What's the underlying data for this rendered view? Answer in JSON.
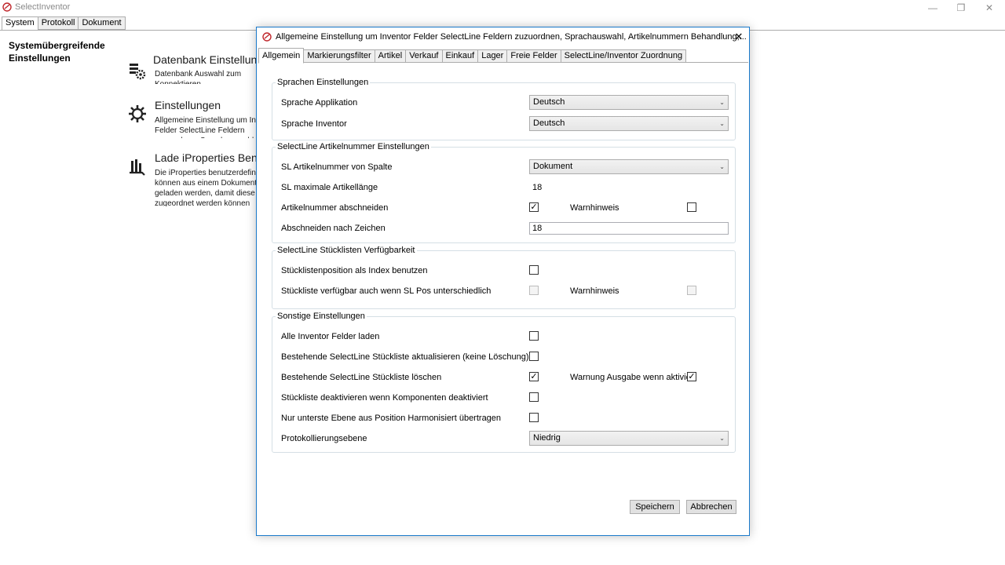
{
  "app": {
    "title": "SelectInventor",
    "window_controls": {
      "minimize": "—",
      "maximize": "❐",
      "close": "✕"
    }
  },
  "main_tabs": [
    {
      "label": "System"
    },
    {
      "label": "Protokoll"
    },
    {
      "label": "Dokument"
    }
  ],
  "main": {
    "heading": "Systemübergreifende Einstellungen",
    "tiles": [
      {
        "icon": "database-settings-icon",
        "title": "Datenbank Einstellungen",
        "description": "Datenbank Auswahl zum Konnektieren"
      },
      {
        "icon": "gear-icon",
        "title": "Einstellungen",
        "description": "Allgemeine Einstellung um Inventor Felder SelectLine Feldern zuzuordnen, Sprachauswahl, Artikelnummern Behandlung,..."
      },
      {
        "icon": "load-properties-icon",
        "title": "Lade iProperties Benutzerdefiniert",
        "description": "Die iProperties benutzerdefiniert können aus einem Dokument geladen werden, damit diese zugeordnet werden können"
      }
    ]
  },
  "dialog": {
    "title": "Allgemeine Einstellung um Inventor Felder SelectLine Feldern zuzuordnen, Sprachauswahl, Artikelnummern Behandlung,...",
    "close": "✕",
    "tabs": [
      {
        "label": "Allgemein"
      },
      {
        "label": "Markierungsfilter"
      },
      {
        "label": "Artikel"
      },
      {
        "label": "Verkauf"
      },
      {
        "label": "Einkauf"
      },
      {
        "label": "Lager"
      },
      {
        "label": "Freie Felder"
      },
      {
        "label": "SelectLine/Inventor Zuordnung"
      }
    ],
    "groups": {
      "sprachen": {
        "legend": "Sprachen Einstellungen",
        "sprache_app": {
          "label": "Sprache Applikation",
          "value": "Deutsch"
        },
        "sprache_inventor": {
          "label": "Sprache Inventor",
          "value": "Deutsch"
        }
      },
      "artikelnummer": {
        "legend": "SelectLine Artikelnummer Einstellungen",
        "von_spalte": {
          "label": "SL Artikelnummer von Spalte",
          "value": "Dokument"
        },
        "max_laenge": {
          "label": "SL maximale Artikellänge",
          "value": "18"
        },
        "abschneiden": {
          "label": "Artikelnummer abschneiden",
          "checked": true,
          "warn_label": "Warnhinweis",
          "warn_checked": false
        },
        "abschneiden_nach": {
          "label": "Abschneiden nach Zeichen",
          "value": "18"
        }
      },
      "stuecklisten": {
        "legend": "SelectLine Stücklisten Verfügbarkeit",
        "position_index": {
          "label": "Stücklistenposition als Index benutzen",
          "checked": false
        },
        "verfuegbar": {
          "label": "Stückliste verfügbar auch wenn SL Pos unterschiedlich",
          "checked": false,
          "warn_label": "Warnhinweis",
          "warn_checked": false
        }
      },
      "sonstige": {
        "legend": "Sonstige Einstellungen",
        "alle_felder": {
          "label": "Alle Inventor Felder laden",
          "checked": false
        },
        "aktualisieren": {
          "label": "Bestehende SelectLine Stückliste aktualisieren (keine Löschung)",
          "checked": false
        },
        "loeschen": {
          "label": "Bestehende SelectLine Stückliste löschen",
          "checked": true,
          "warn_label": "Warnung Ausgabe wenn aktiviert",
          "warn_checked": true
        },
        "deaktivieren": {
          "label": "Stückliste deaktivieren wenn Komponenten deaktiviert",
          "checked": false
        },
        "unterste_ebene": {
          "label": "Nur unterste Ebene aus Position Harmonisiert übertragen",
          "checked": false
        },
        "protokoll": {
          "label": "Protokollierungsebene",
          "value": "Niedrig"
        }
      }
    },
    "buttons": {
      "save": "Speichern",
      "cancel": "Abbrechen"
    }
  },
  "colors": {
    "dialog_border": "#1979ca",
    "group_border": "#d5dfe5",
    "logo": "#c0282d"
  }
}
